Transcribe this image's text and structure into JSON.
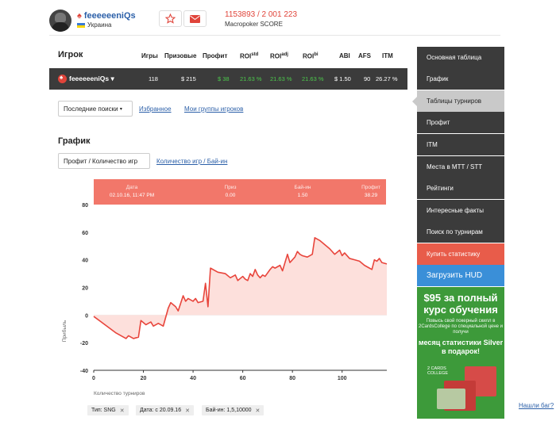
{
  "header": {
    "player_name": "feeeeeeniQs",
    "country": "Украина",
    "score": "1153893 / 2 001 223",
    "score_label": "Macropoker SCORE"
  },
  "table": {
    "title": "Игрок",
    "columns": [
      "Игры",
      "Призовые",
      "Профит",
      "ROI",
      "ROI",
      "ROI",
      "ABI",
      "AFS",
      "ITM"
    ],
    "roi_sups": [
      "std",
      "adj",
      "bi"
    ],
    "row": {
      "name": "feeeeeeniQs",
      "games": "118",
      "prize": "$ 215",
      "profit": "$ 38",
      "roi_std": "21.63 %",
      "roi_adj": "21.63 %",
      "roi_bi": "21.63 %",
      "abi": "$ 1.50",
      "afs": "90",
      "itm": "26.27 %"
    }
  },
  "filters": {
    "dropdown": "Последние поиски",
    "favorites": "Избранное",
    "my_groups": "Мои группы игроков"
  },
  "graph": {
    "title": "График",
    "tab_active": "Профит / Количество игр",
    "tab_link": "Количество игр / Бай-ин",
    "tooltip": {
      "date_label": "Дата",
      "date_value": "02.10.16, 11:47 PM",
      "prize_label": "Приз",
      "prize_value": "0.00",
      "buyin_label": "Бай-ин",
      "buyin_value": "1.50",
      "profit_label": "Профит",
      "profit_value": "38.29"
    },
    "tags": [
      "Тип: SNG",
      "Дата: с 20.09.16",
      "Бай-ин: 1,5,10000"
    ]
  },
  "chart_data": {
    "type": "area",
    "xlabel": "Количество турниров",
    "ylabel": "Прибыль",
    "xlim": [
      0,
      118
    ],
    "ylim": [
      -40,
      80
    ],
    "xticks": [
      0,
      20,
      40,
      60,
      80,
      100
    ],
    "yticks": [
      -40,
      -20,
      0,
      20,
      40,
      60,
      80
    ],
    "color": "#e8453c",
    "fill": "#fde0dc",
    "x": [
      0,
      3,
      6,
      9,
      11,
      13,
      14,
      16,
      18,
      19,
      21,
      23,
      24,
      26,
      28,
      30,
      31,
      33,
      34,
      36,
      37,
      38,
      40,
      41,
      42,
      44,
      45,
      46,
      47,
      50,
      53,
      55,
      57,
      58,
      60,
      61,
      62,
      63,
      64,
      65,
      66,
      67,
      68,
      69,
      71,
      72,
      73,
      75,
      76,
      78,
      79,
      81,
      82,
      83,
      84,
      86,
      88,
      89,
      91,
      93,
      95,
      97,
      99,
      100,
      101,
      103,
      105,
      107,
      109,
      111,
      112,
      113,
      114,
      115,
      116,
      118
    ],
    "values": [
      -1,
      -5,
      -9,
      -13,
      -15,
      -17,
      -15,
      -17,
      -16,
      -4,
      -7,
      -5,
      -8,
      -6,
      -8,
      5,
      9,
      6,
      3,
      14,
      10,
      12,
      10,
      12,
      9,
      10,
      23,
      6,
      34,
      31,
      30,
      27,
      29,
      25,
      28,
      26,
      25,
      30,
      28,
      33,
      29,
      27,
      29,
      28,
      33,
      35,
      34,
      36,
      32,
      44,
      38,
      42,
      46,
      44,
      43,
      42,
      44,
      56,
      54,
      51,
      48,
      44,
      47,
      43,
      45,
      41,
      40,
      39,
      36,
      34,
      33,
      40,
      39,
      41,
      38,
      37
    ]
  },
  "sidebar": {
    "items": [
      "Основная таблица",
      "График",
      "Таблицы турниров",
      "Профит",
      "ITM",
      "Места в МТТ / STT",
      "Рейтинги",
      "Интересные факты",
      "Поиск по турнирам"
    ],
    "buy_stats": "Купить статистику",
    "download_hud": "Загрузить HUD"
  },
  "ad": {
    "headline": "$95 за полный курс обучения",
    "body": "Повысь свой покерный скилл в 2CardsCollege по специальной цене и получи",
    "offer": "месяц статистики Silver в подарок!",
    "logo": "2 CARDS COLLEGE"
  },
  "help_link": "Нашли баг?"
}
